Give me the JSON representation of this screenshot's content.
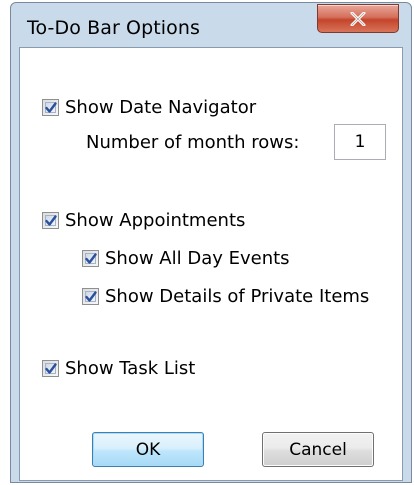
{
  "dialog": {
    "title": "To-Do Bar Options",
    "close_icon": "close-x-icon"
  },
  "options": {
    "date_navigator": {
      "label": "Show Date Navigator",
      "checked": true
    },
    "month_rows": {
      "label": "Number of month rows:",
      "value": "1"
    },
    "appointments": {
      "label": "Show Appointments",
      "checked": true
    },
    "all_day_events": {
      "label": "Show All Day Events",
      "checked": true
    },
    "private_items": {
      "label": "Show Details of Private Items",
      "checked": true
    },
    "task_list": {
      "label": "Show Task List",
      "checked": true
    }
  },
  "buttons": {
    "ok_label": "OK",
    "cancel_label": "Cancel"
  },
  "colors": {
    "frame": "#c9daeb",
    "close_button": "#c4452b",
    "checkmark": "#2a4f9c",
    "ok_border": "#3c7fb1"
  }
}
